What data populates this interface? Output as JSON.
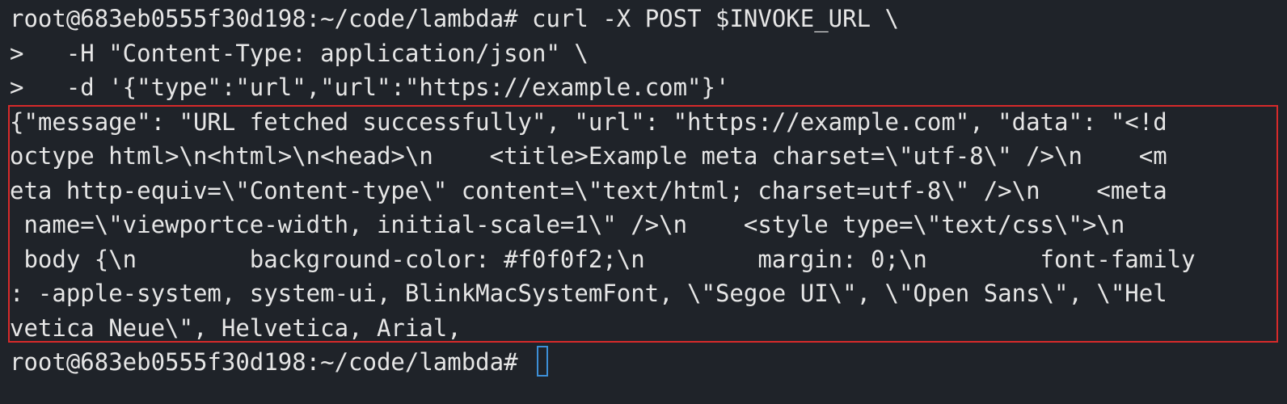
{
  "terminal": {
    "prompt": "root@683eb0555f30d198:~/code/lambda# ",
    "command_lines": [
      "curl -X POST $INVOKE_URL \\",
      ">   -H \"Content-Type: application/json\" \\",
      ">   -d '{\"type\":\"url\",\"url\":\"https://example.com\"}'"
    ],
    "output_lines": [
      "{\"message\": \"URL fetched successfully\", \"url\": \"https://example.com\", \"data\": \"<!d",
      "octype html>\\n<html>\\n<head>\\n    <title>Example meta charset=\\\"utf-8\\\" />\\n    <m",
      "eta http-equiv=\\\"Content-type\\\" content=\\\"text/html; charset=utf-8\\\" />\\n    <meta",
      " name=\\\"viewportce-width, initial-scale=1\\\" />\\n    <style type=\\\"text/css\\\">\\n",
      " body {\\n        background-color: #f0f0f2;\\n        margin: 0;\\n        font-family",
      ": -apple-system, system-ui, BlinkMacSystemFont, \\\"Segoe UI\\\", \\\"Open Sans\\\", \\\"Hel",
      "vetica Neue\\\", Helvetica, Arial,"
    ],
    "final_prompt": "root@683eb0555f30d198:~/code/lambda# "
  },
  "colors": {
    "background": "#1f2329",
    "text": "#e6e6e6",
    "highlight_border": "#d62a2a",
    "cursor": "#3d8fd6"
  }
}
